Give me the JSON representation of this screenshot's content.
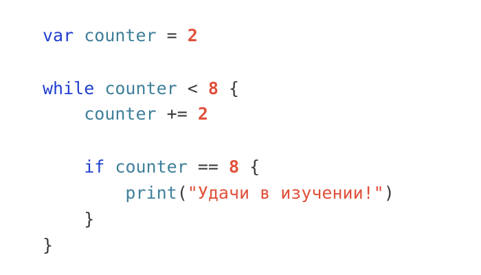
{
  "code": {
    "line1": {
      "kw": "var",
      "ident": "counter",
      "op": "=",
      "num": "2"
    },
    "line3": {
      "kw": "while",
      "ident": "counter",
      "op": "<",
      "num": "8",
      "brace": "{"
    },
    "line4": {
      "ident": "counter",
      "op": "+=",
      "num": "2"
    },
    "line6": {
      "kw": "if",
      "ident": "counter",
      "op": "==",
      "num": "8",
      "brace": "{"
    },
    "line7": {
      "fn": "print",
      "open": "(",
      "str": "\"Удачи в изучении!\"",
      "close": ")"
    },
    "line8": {
      "brace": "}"
    },
    "line9": {
      "brace": "}"
    }
  },
  "colors": {
    "keyword": "#1f3fcf",
    "identifier": "#3f7f9a",
    "number": "#e0503a",
    "string": "#e0503a",
    "punctuation": "#3a3a3a",
    "background": "#ffffff"
  }
}
